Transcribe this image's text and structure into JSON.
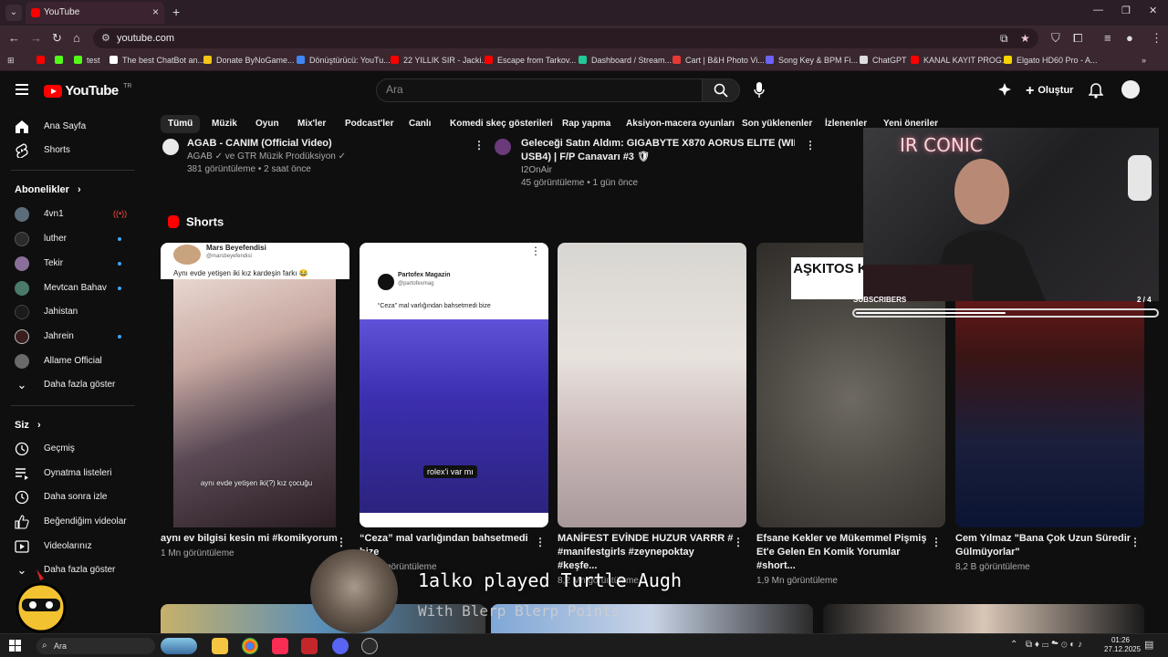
{
  "browser": {
    "tab_title": "YouTube",
    "url": "youtube.com",
    "bookmarks": [
      {
        "label": "",
        "color": "#ff0000"
      },
      {
        "label": "",
        "color": "#53fc18"
      },
      {
        "label": "test",
        "color": "#53fc18"
      },
      {
        "label": "The best ChatBot an...",
        "color": "#ffffff"
      },
      {
        "label": "Donate ByNoGame...",
        "color": "#f5c518"
      },
      {
        "label": "Dönüştürücü: YouTu...",
        "color": "#4285f4"
      },
      {
        "label": "22 YILLIK SIR - Jacki...",
        "color": "#ff0000"
      },
      {
        "label": "Escape from Tarkov...",
        "color": "#ff0000"
      },
      {
        "label": "Dashboard / Stream...",
        "color": "#20c997"
      },
      {
        "label": "Cart | B&H Photo Vi...",
        "color": "#e53935"
      },
      {
        "label": "Song Key & BPM Fi...",
        "color": "#6c63ff"
      },
      {
        "label": "ChatGPT",
        "color": "#dddddd"
      },
      {
        "label": "KANAL KAYIT PROG...",
        "color": "#ff0000"
      },
      {
        "label": "Elgato HD60 Pro - A...",
        "color": "#f5d400"
      }
    ]
  },
  "header": {
    "logo_text": "YouTube",
    "logo_region": "TR",
    "search_placeholder": "Ara",
    "create_label": "Oluştur"
  },
  "sidebar": {
    "main": [
      {
        "label": "Ana Sayfa",
        "icon": "home-icon"
      },
      {
        "label": "Shorts",
        "icon": "shorts-icon"
      }
    ],
    "subs_heading": "Abonelikler",
    "subscriptions": [
      {
        "label": "4vn1",
        "status": "live",
        "color": "#5b6c7a"
      },
      {
        "label": "luther",
        "status": "new",
        "color": "#2b2b2b"
      },
      {
        "label": "Tekir",
        "status": "new",
        "color": "#8a6f9a"
      },
      {
        "label": "Mevtcan Bahav",
        "status": "new",
        "color": "#4a7a6a"
      },
      {
        "label": "Jahistan",
        "status": "",
        "color": "#1b1b1b"
      },
      {
        "label": "Jahrein",
        "status": "new",
        "color": "#3a1e1e"
      },
      {
        "label": "Allame Official",
        "status": "",
        "color": "#6a6a6a"
      }
    ],
    "show_more": "Daha fazla göster",
    "you_heading": "Siz",
    "you_items": [
      {
        "label": "Geçmiş",
        "icon": "history-icon"
      },
      {
        "label": "Oynatma listeleri",
        "icon": "playlists-icon"
      },
      {
        "label": "Daha sonra izle",
        "icon": "watch-later-icon"
      },
      {
        "label": "Beğendiğim videolar",
        "icon": "liked-icon"
      },
      {
        "label": "Videolarınız",
        "icon": "your-videos-icon"
      },
      {
        "label": "Daha fazla göster",
        "icon": "chevron-down-icon"
      }
    ]
  },
  "chips": [
    "Tümü",
    "Müzik",
    "Oyun",
    "Mix'ler",
    "Podcast'ler",
    "Canlı",
    "Komedi skeç gösterileri",
    "Rap yapma",
    "Aksiyon-macera oyunları",
    "Son yüklenenler",
    "İzlenenler",
    "Yeni öneriler"
  ],
  "videos_top": [
    {
      "title": "AGAB - CANIM (Official Video)",
      "channel": "AGAB ✓ ve GTR Müzik Prodüksiyon ✓",
      "stats": "381 görüntüleme • 2 saat önce"
    },
    {
      "title": "Geleceği Satın Aldım: GIGABYTE X870 AORUS ELITE (WIFI 7 &",
      "title2": "USB4) | F/P Canavarı #3 🛡",
      "channel": "I2OnAir",
      "stats": "45 görüntüleme • 1 gün önce"
    }
  ],
  "shorts": {
    "heading": "Shorts",
    "items": [
      {
        "title": "aynı ev bilgisi kesin mi #komikyorum",
        "views": "1 Mn görüntüleme",
        "overlay_name": "Mars Beyefendisi",
        "overlay_handle": "@marsbeyefendisi",
        "overlay_caption": "Aynı evde yetişen iki kız kardeşin farkı 😂",
        "overlay_sub": "aynı evde yetişen iki(?) kız çocuğu"
      },
      {
        "title": "“Ceza” mal varlığından bahsetmedi bize",
        "views": "860 B görüntüleme",
        "overlay_name": "Partofex Magazin",
        "overlay_handle": "@partofexmag",
        "overlay_caption": "“Ceza” mal varlığından bahsetmedi bize",
        "overlay_sub": "rolex'i var mı"
      },
      {
        "title": "MANİFEST EVİNDE HUZUR VARRR # #manifestgirls #zeynepoktay #keşfe...",
        "views": "8,2 Mn görüntüleme"
      },
      {
        "title": "Efsane Kekler ve Mükemmel Pişmiş Et'e Gelen En Komik Yorumlar #short...",
        "views": "1,9 Mn görüntüleme",
        "overlay_banner": "AŞKITOS KEK YA"
      },
      {
        "title": "Cem Yılmaz \"Bana Çok Uzun Süredir Gülmüyorlar\"",
        "views": "8,2 B görüntüleme"
      }
    ]
  },
  "overlay": {
    "cam_sign": "IR CONIC",
    "subscribers_label": "SUBSCRIBERS",
    "subscribers_count": "2 / 4",
    "subscribers_progress": 0.5,
    "alert_title": "1alko played Turtle Augh",
    "alert_sub": "With Blerp Blerp Points"
  },
  "taskbar": {
    "search_label": "Ara",
    "time": "01:26",
    "date": "27.12.2025"
  }
}
